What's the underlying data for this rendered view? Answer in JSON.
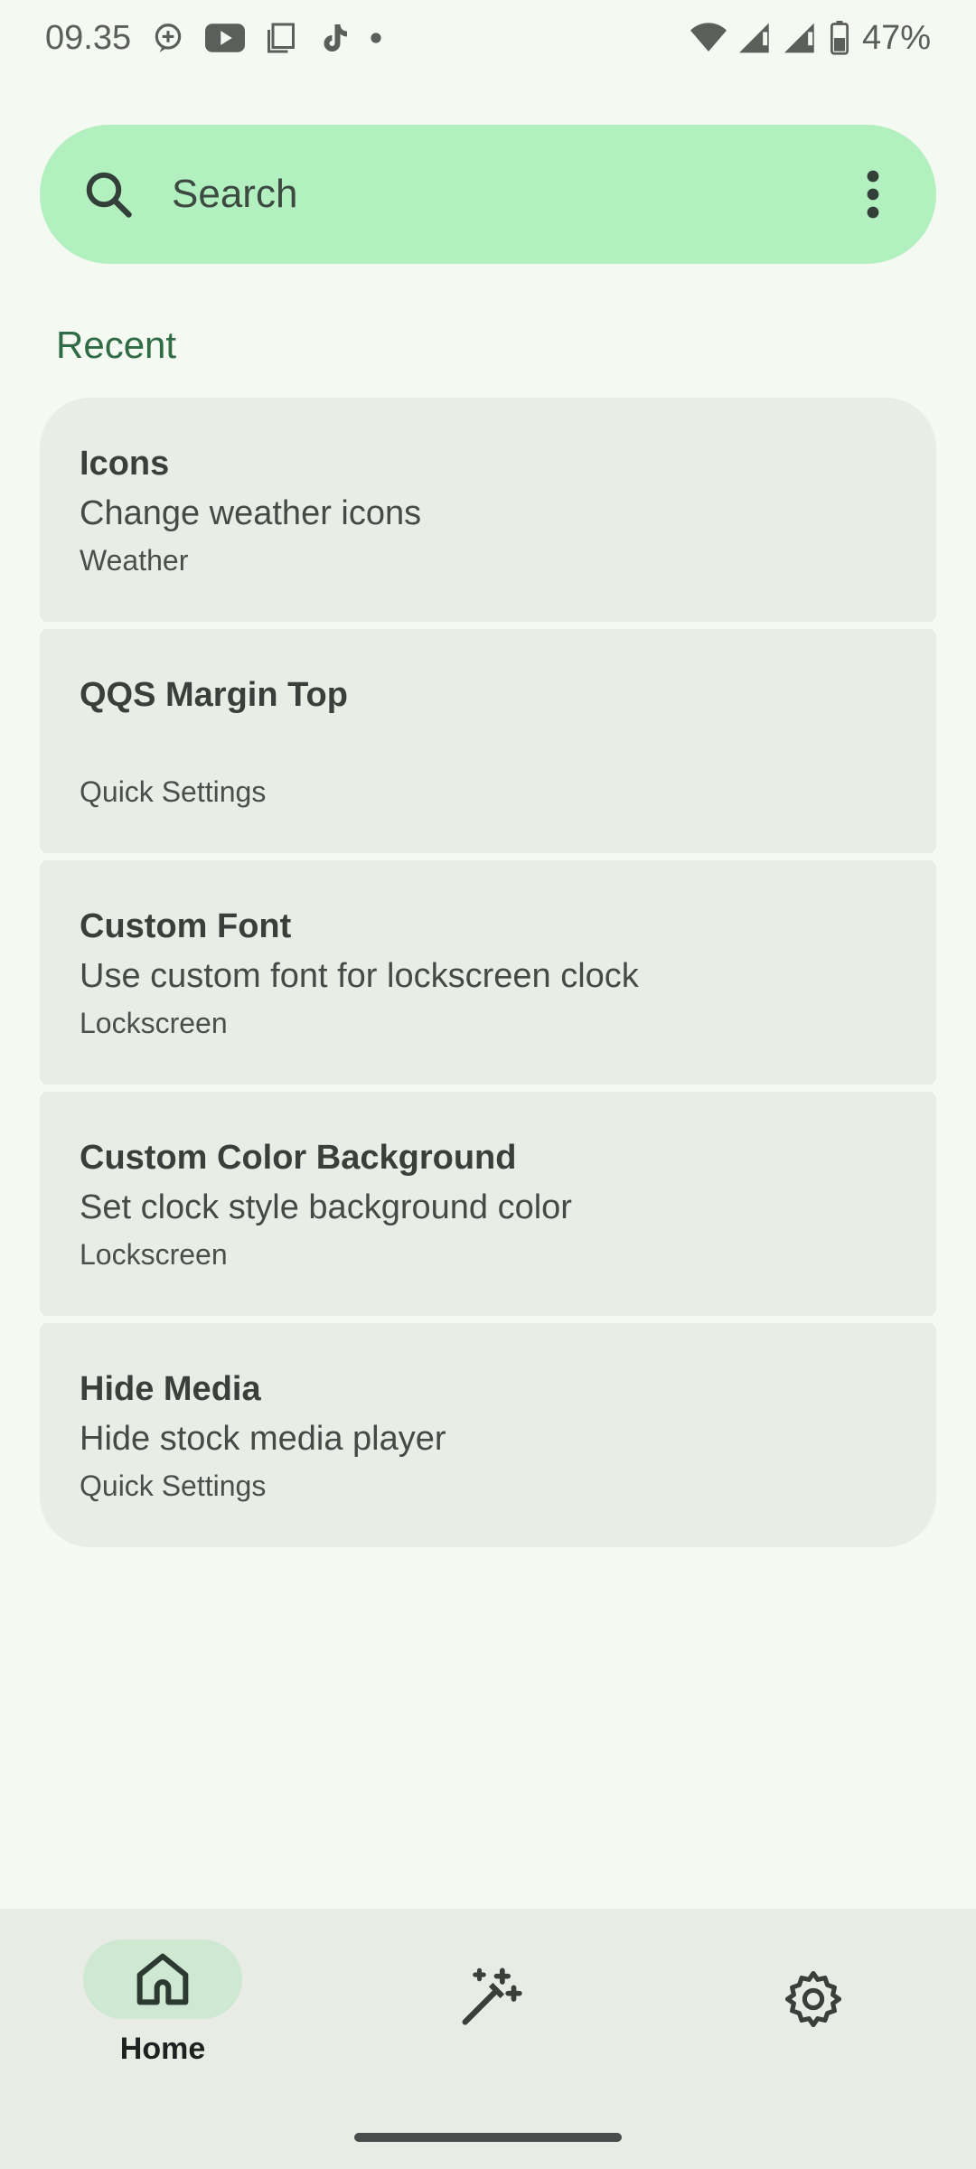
{
  "status_bar": {
    "time": "09.35",
    "battery": "47%"
  },
  "search": {
    "placeholder": "Search"
  },
  "recent": {
    "title": "Recent",
    "items": [
      {
        "title": "Icons",
        "description": "Change weather icons",
        "category": "Weather"
      },
      {
        "title": "QQS Margin Top",
        "description": "",
        "category": "Quick Settings"
      },
      {
        "title": "Custom Font",
        "description": "Use custom font for lockscreen clock",
        "category": "Lockscreen"
      },
      {
        "title": "Custom Color Background",
        "description": "Set clock style background color",
        "category": "Lockscreen"
      },
      {
        "title": "Hide Media",
        "description": "Hide stock media player",
        "category": "Quick Settings"
      }
    ]
  },
  "bottom_nav": {
    "items": [
      {
        "label": "Home",
        "icon": "home-icon",
        "selected": true
      },
      {
        "label": "",
        "icon": "magic-wand-icon",
        "selected": false
      },
      {
        "label": "",
        "icon": "gear-icon",
        "selected": false
      }
    ]
  },
  "colors": {
    "background": "#f4f9f1",
    "search_bar": "#b3f0c0",
    "card": "#eaede6",
    "accent": "#2f6b45",
    "nav_selected": "#cfe8d2"
  }
}
